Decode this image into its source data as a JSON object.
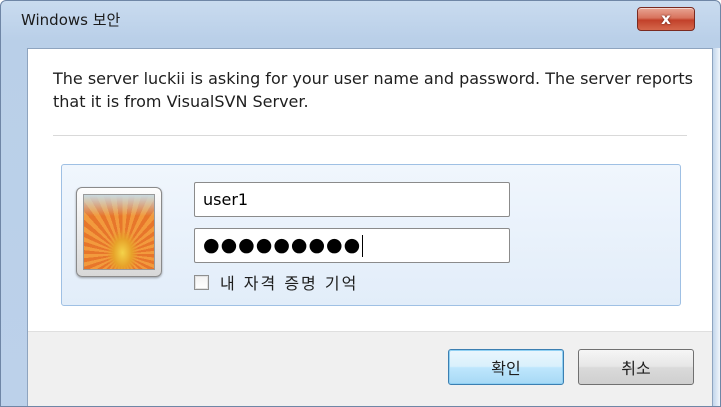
{
  "window": {
    "title": "Windows 보안",
    "close_label": "x"
  },
  "dialog": {
    "message": "The server luckii is asking for your user name and password. The server reports that it is from VisualSVN Server.",
    "username_value": "user1",
    "password_mask": "●●●●●●●●●",
    "remember_label": "내 자격 증명 기억",
    "remember_checked": false
  },
  "buttons": {
    "ok_label": "확인",
    "cancel_label": "취소"
  },
  "icons": {
    "avatar": "user-tile-flower-icon",
    "close": "close-icon",
    "checkbox": "checkbox-unchecked"
  },
  "colors": {
    "frame": "#b9cfe8",
    "close_button": "#c2412a",
    "tile_border": "#9fc0e4",
    "ok_border": "#3c7fb1"
  }
}
